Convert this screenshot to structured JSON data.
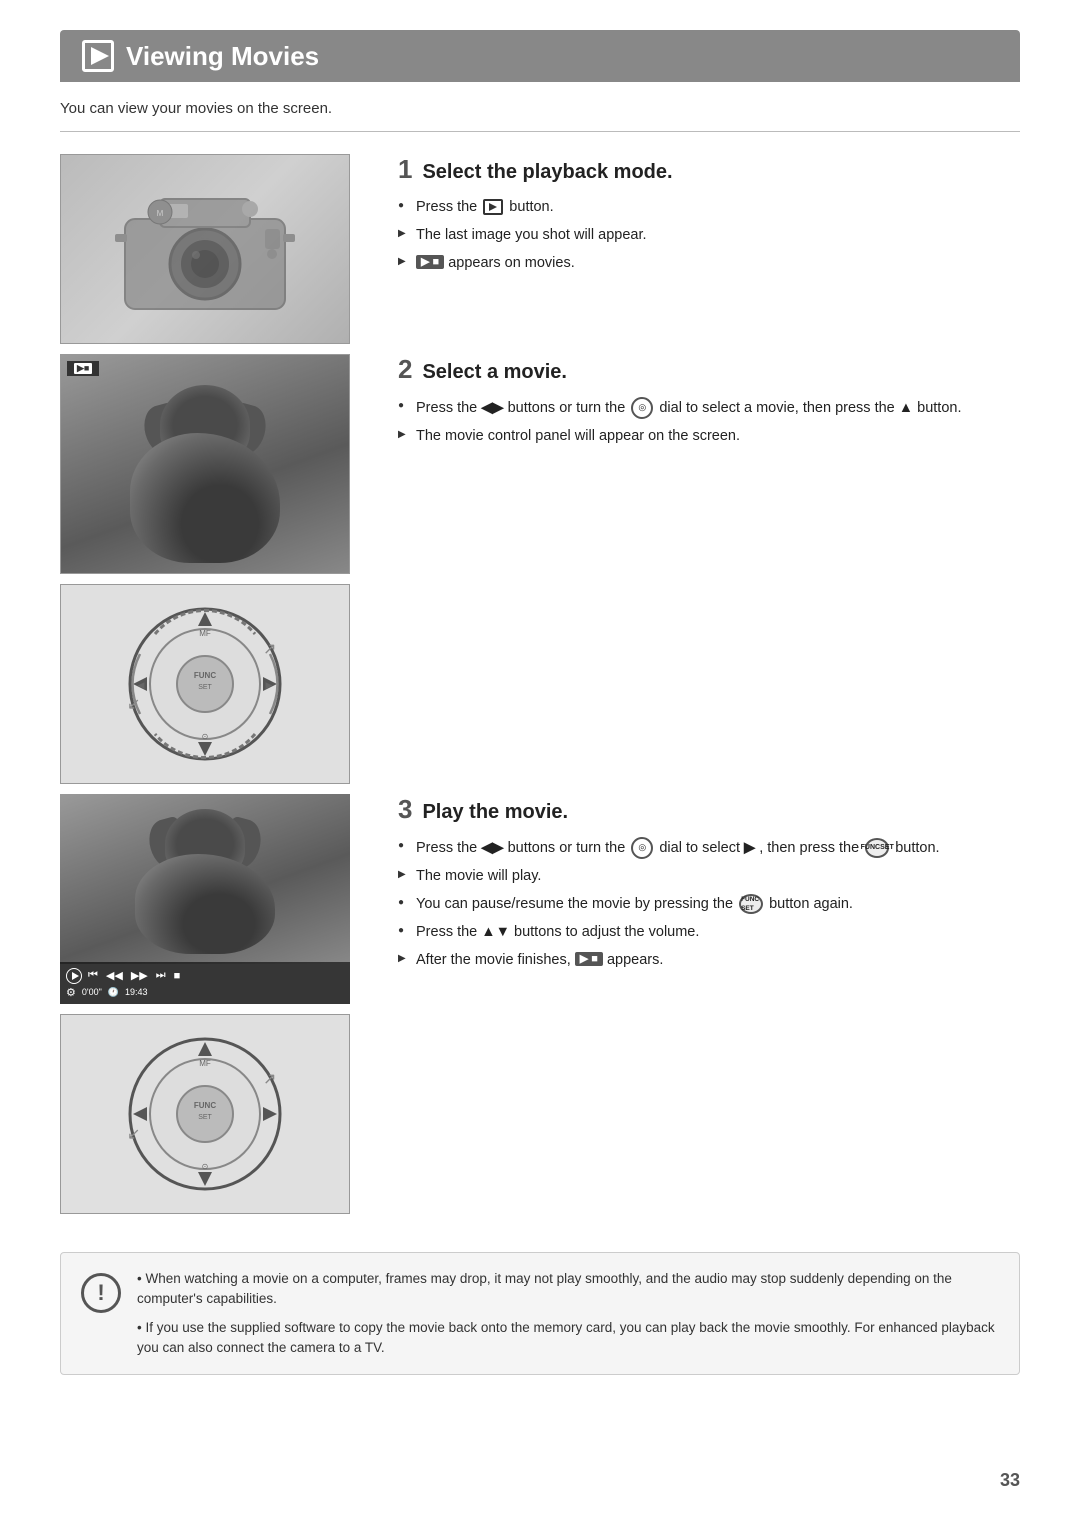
{
  "header": {
    "icon_label": "play-icon",
    "title": "Viewing Movies"
  },
  "subtitle": "You can view your movies on the screen.",
  "steps": [
    {
      "number": "1",
      "title": "Select the playback mode.",
      "bullets": [
        {
          "type": "circle",
          "text": "Press the ▶ button."
        },
        {
          "type": "arrow",
          "text": "The last image you shot will appear."
        },
        {
          "type": "arrow",
          "text": "🎬 appears on movies."
        }
      ]
    },
    {
      "number": "2",
      "title": "Select a movie.",
      "bullets": [
        {
          "type": "circle",
          "text": "Press the ◀▶ buttons or turn the ◎ dial to select a movie, then press the ▲ button."
        },
        {
          "type": "arrow",
          "text": "The movie control panel will appear on the screen."
        }
      ]
    },
    {
      "number": "3",
      "title": "Play the movie.",
      "bullets": [
        {
          "type": "circle",
          "text": "Press the ◀▶ buttons or turn the ◎ dial to select ▶ , then press the FUNC/SET button."
        },
        {
          "type": "arrow",
          "text": "The movie will play."
        },
        {
          "type": "circle",
          "text": "You can pause/resume the movie by pressing the FUNC/SET button again."
        },
        {
          "type": "circle",
          "text": "Press the ▲▼ buttons to adjust the volume."
        },
        {
          "type": "arrow",
          "text": "After the movie finishes, 🎬 appears."
        }
      ]
    }
  ],
  "note": {
    "icon": "!",
    "bullets": [
      "When watching a movie on a computer, frames may drop, it may not play smoothly, and the audio may stop suddenly depending on the computer's capabilities.",
      "If you use the supplied software to copy the movie back onto the memory card, you can play back the movie smoothly. For enhanced playback you can also connect the camera to a TV."
    ]
  },
  "page_number": "33",
  "movie_time": "0'00\"",
  "movie_clock": "19:43"
}
